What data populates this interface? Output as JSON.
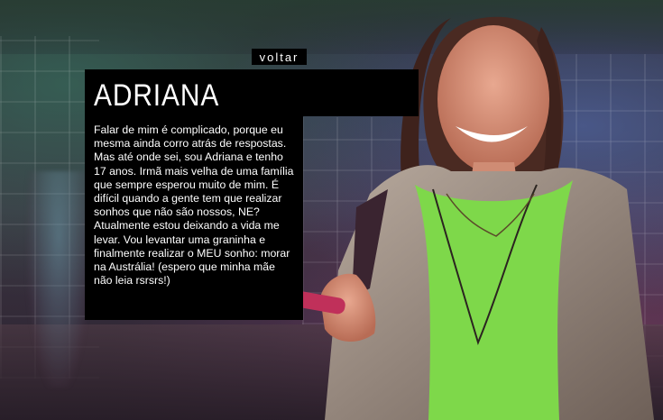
{
  "nav": {
    "back_label": "voltar"
  },
  "profile": {
    "name": "ADRIANA",
    "bio": "Falar de mim é complicado, porque eu mesma ainda corro atrás de respostas. Mas até onde sei, sou Adriana e tenho 17 anos. Irmã mais velha de uma família que sempre esperou muito de mim. É difícil quando a gente tem que realizar sonhos que não são nossos, NE? Atualmente estou deixando a vida me levar. Vou levantar uma graninha e finalmente realizar o MEU sonho: morar na Austrália! (espero que minha mãe não leia rsrsrs!)"
  },
  "colors": {
    "panel": "#000000",
    "text": "#ffffff",
    "shirt": "#7ed84a",
    "hoodie": "#a99a8e",
    "phone": "#c0305a"
  }
}
